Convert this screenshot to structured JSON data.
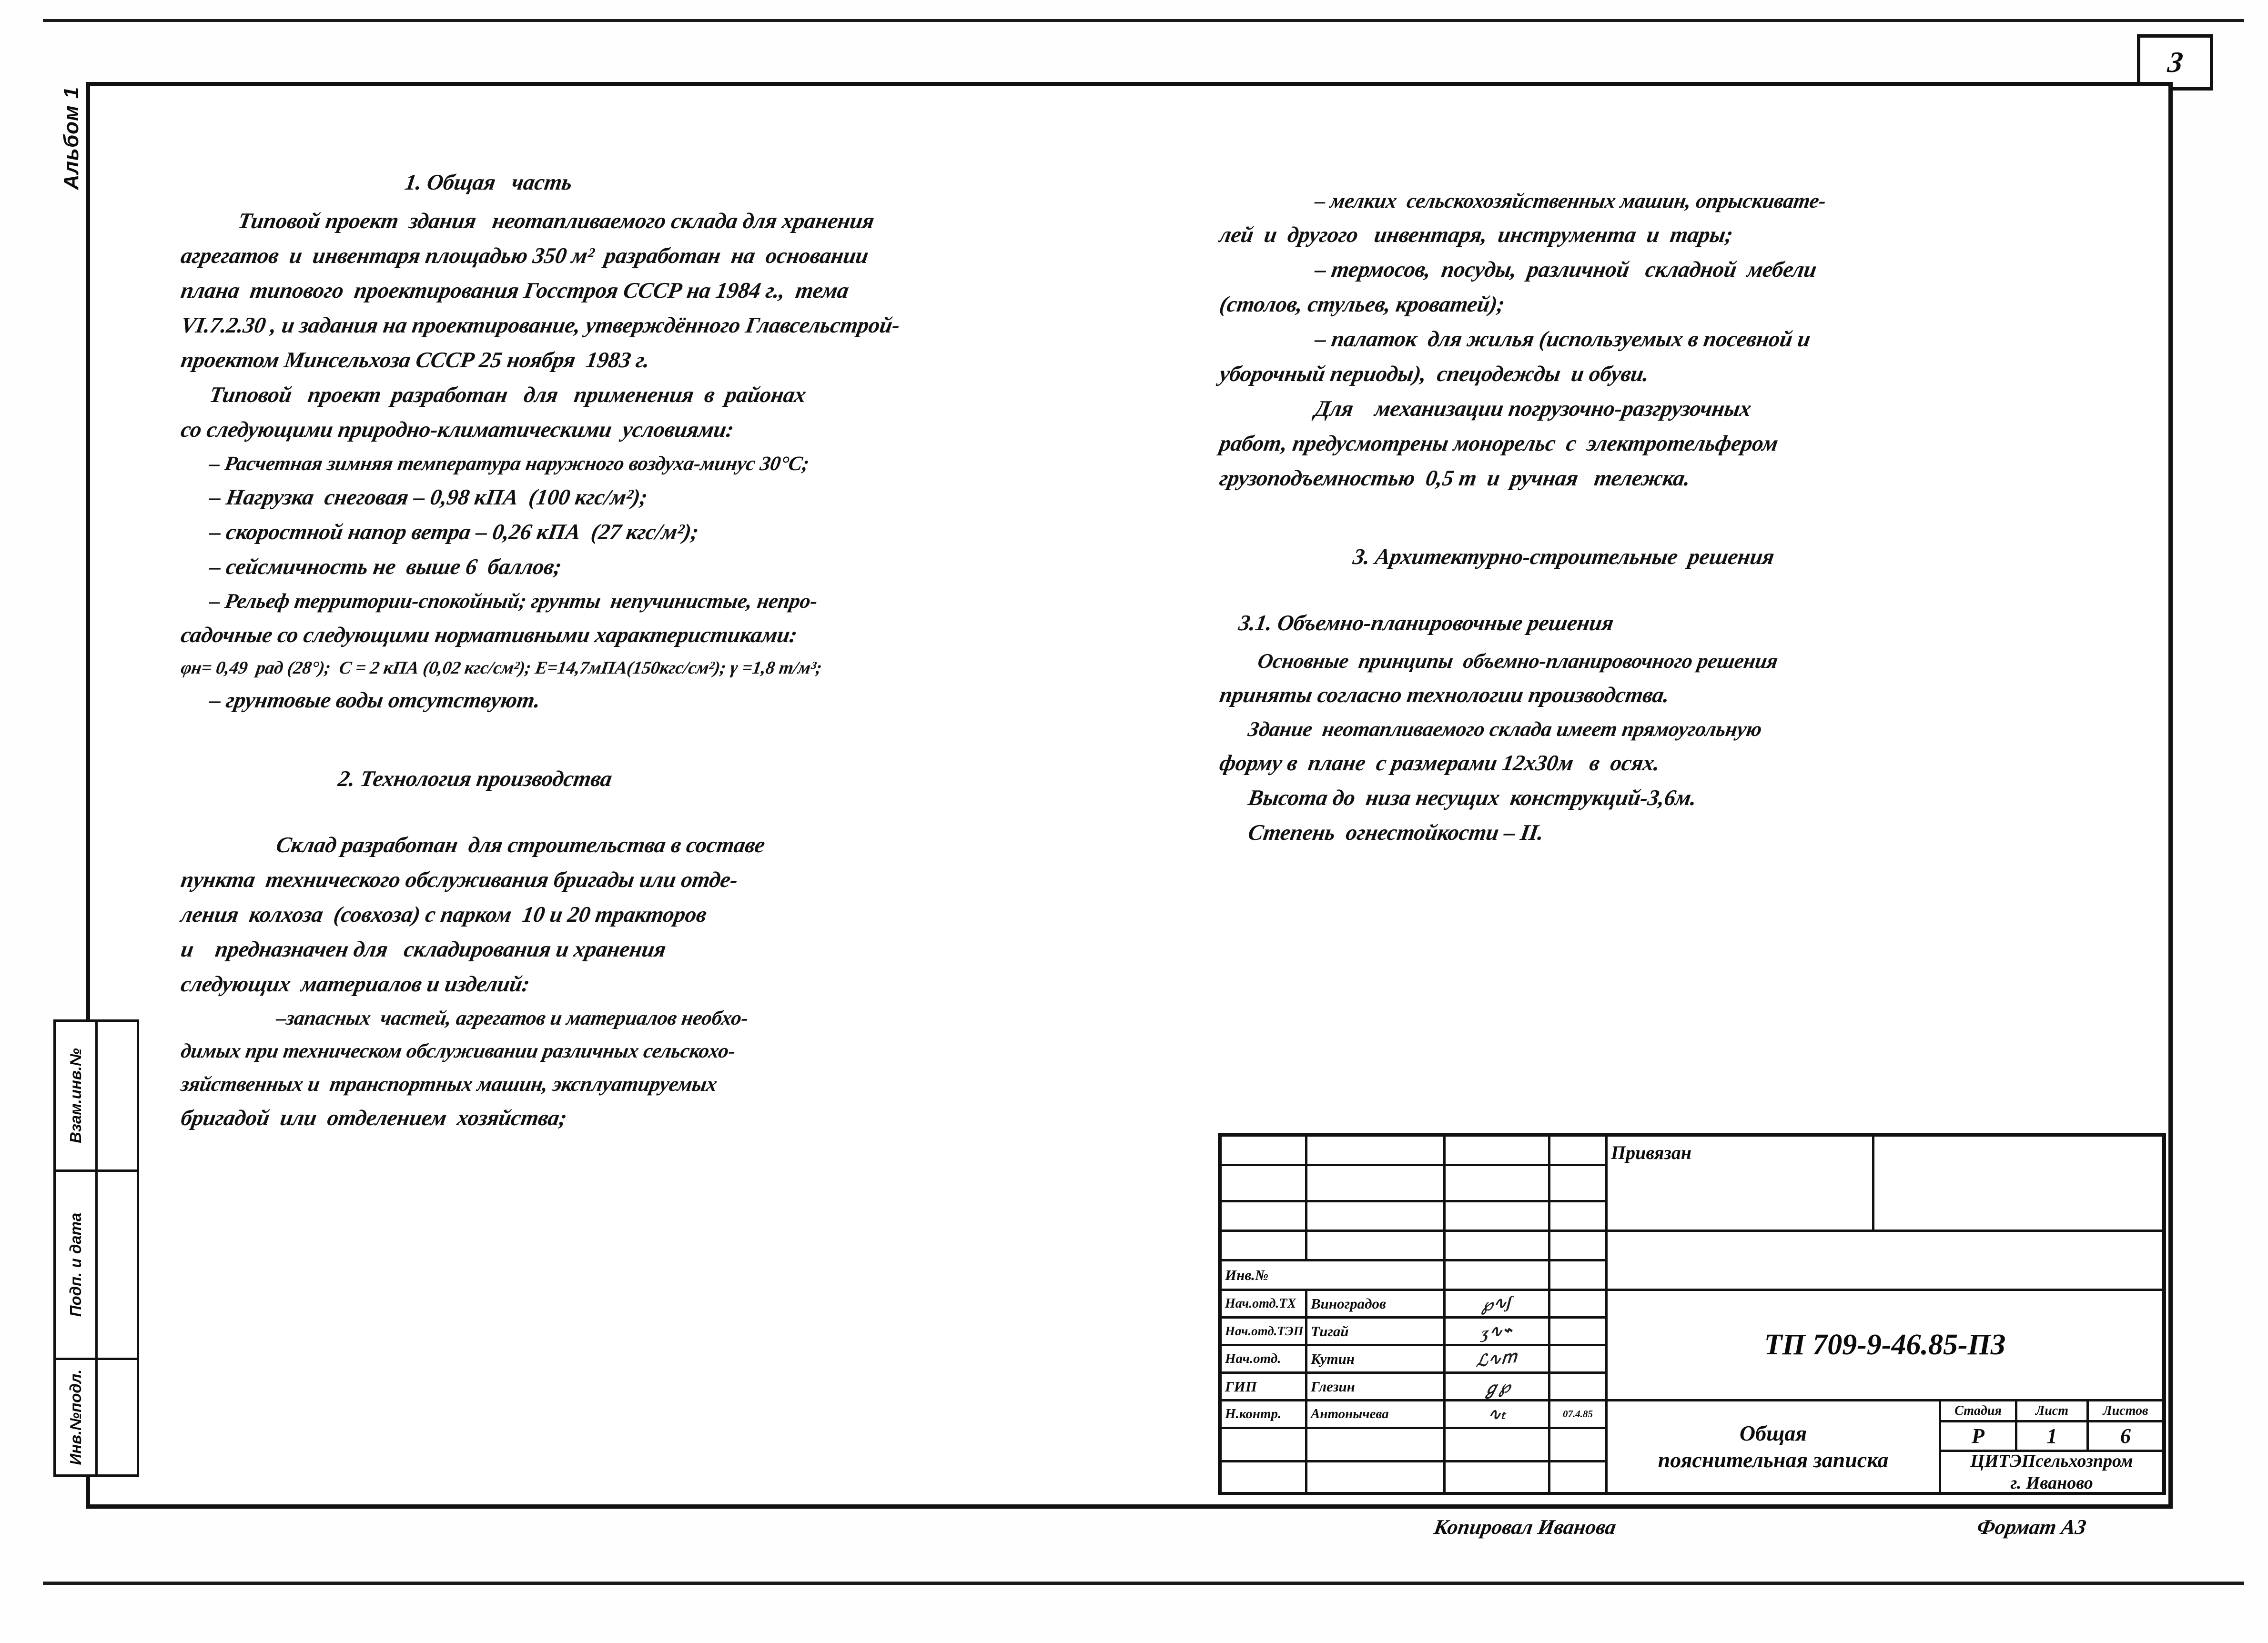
{
  "sheet": {
    "page_number": "3",
    "album_label": "Альбом 1",
    "copier_label": "Копировал Иванова",
    "format_label": "Формат А3"
  },
  "side_strip": {
    "rows": [
      {
        "label": "Взам.инв.№"
      },
      {
        "label": "Подп. и дата"
      },
      {
        "label": "Инв.№подл."
      }
    ]
  },
  "left_column": {
    "heading": "1. Общая   часть",
    "lines": [
      "Типовой проект  здания   неотапливаемого склада для хранения",
      "агрегатов  и  инвентаря площадью 350 м²  разработан  на  основании",
      "плана  типового  проектирования Госстроя СССР на 1984 г.,  тема",
      "VI.7.2.30 , и задания на проектирование, утверждённого Главсельстрой-",
      "проектом Минсельхоза СССР 25 ноября  1983 г.",
      "Типовой   проект  разработан   для   применения  в  районах",
      "со следующими природно-климатическими  условиями:",
      "– Расчетная зимняя температура наружного воздуха-минус 30°С;",
      "– Нагрузка  снеговая – 0,98 кПА  (100 кгс/м²);",
      "– скоростной напор ветра – 0,26 кПА  (27 кгс/м²);",
      "– сейсмичность не  выше 6  баллов;",
      "– Рельеф территории-спокойный; грунты  непучинистые, непро-",
      "садочные со следующими нормативными характеристиками:",
      "φн= 0,49  рад (28°);  С = 2 кПА (0,02 кгс/см²); Е=14,7мПА(150кгс/см²); γ =1,8 т/м³;",
      "– грунтовые воды отсутствуют."
    ],
    "heading2": "2. Технология производства",
    "lines2": [
      "Склад разработан  для строительства в составе",
      "пункта  технического обслуживания бригады или отде-",
      "ления  колхоза  (совхоза) с парком  10 и 20 тракторов",
      "и    предназначен для   складирования и хранения",
      "следующих  материалов и изделий:",
      "–запасных  частей, агрегатов и материалов необхо-",
      "димых при техническом обслуживании различных сельскохо-",
      "зяйственных и  транспортных машин, эксплуатируемых",
      "бригадой  или  отделением  хозяйства;"
    ]
  },
  "right_column": {
    "lines": [
      "– мелких  сельскохозяйственных машин, опрыскивате-",
      "лей  и  другого   инвентаря,  инструмента  и  тары;",
      "– термосов,  посуды,  различной   складной  мебели",
      "(столов, стульев, кроватей);",
      "– палаток  для жилья (используемых в посевной и",
      "уборочный периоды),  спецодежды  и обуви.",
      "Для    механизации погрузочно-разгрузочных",
      "работ, предусмотрены монорельс  с  электротельфером",
      "грузоподъемностью  0,5 т  и  ручная   тележка."
    ],
    "heading3": "3. Архитектурно-строительные  решения",
    "heading31": "3.1. Объемно-планировочные решения",
    "lines3": [
      "Основные  принципы  объемно-планировочного решения",
      "приняты согласно технологии производства.",
      "Здание  неотапливаемого склада имеет прямоугольную",
      "форму в  плане  с размерами 12х30м   в  осях.",
      "Высота до  низа несущих  конструкций-3,6м.",
      "Степень  огнестойкости – II."
    ]
  },
  "title_block": {
    "privyazan_label": "Привязан",
    "inv_label": "Инв.№",
    "designation": "ТП 709-9-46.85-ПЗ",
    "doc_title_line1": "Общая",
    "doc_title_line2": "пояснительная  записка",
    "org_line1": "ЦИТЭПсельхозпром",
    "org_line2": "г. Иваново",
    "stage_headers": [
      "Стадия",
      "Лист",
      "Листов"
    ],
    "stage_values": [
      "Р",
      "1",
      "6"
    ],
    "signers": [
      {
        "role": "Нач.отд.ТХ",
        "name": "Виноградов",
        "sign": "✓",
        "date": ""
      },
      {
        "role": "Нач.отд.ТЭП",
        "name": "Тигай",
        "sign": "✓",
        "date": ""
      },
      {
        "role": "Нач.отд.",
        "name": "Кутин",
        "sign": "✓",
        "date": ""
      },
      {
        "role": "ГИП",
        "name": "Глезин",
        "sign": "✓",
        "date": ""
      },
      {
        "role": "Н.контр.",
        "name": "Антонычева",
        "sign": "✓",
        "date": "07.4.85"
      }
    ]
  }
}
